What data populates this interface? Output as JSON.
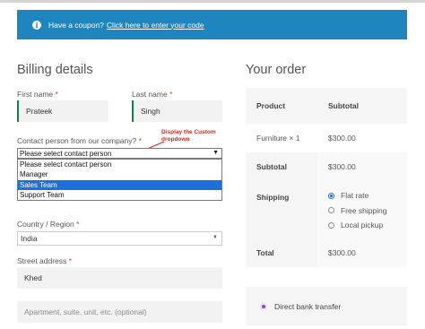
{
  "coupon": {
    "icon": "info-icon",
    "lead_text": "Have a coupon?",
    "link_text": "Click here to enter your code",
    "background": "#1e85be"
  },
  "billing": {
    "title": "Billing details",
    "first_name": {
      "label": "First name",
      "required": "*",
      "value": "Prateek"
    },
    "last_name": {
      "label": "Last name",
      "required": "*",
      "value": "Singh"
    },
    "contact_person": {
      "label": "Contact person from our company?",
      "required": "*",
      "selected": "Please select contact person",
      "options": [
        "Please select contact person",
        "Manager",
        "Sales Team",
        "Support Team"
      ],
      "highlighted_option": "Sales Team"
    },
    "annotation": "Display the Custom dropdown",
    "country": {
      "label": "Country / Region",
      "required": "*",
      "value": "India"
    },
    "street": {
      "label": "Street address",
      "required": "*",
      "value": "Khed",
      "line2_placeholder": "Apartment, suite, unit, etc. (optional)"
    }
  },
  "order": {
    "title": "Your order",
    "header": {
      "product": "Product",
      "subtotal": "Subtotal"
    },
    "item": {
      "name": "Furniture",
      "qty": "× 1",
      "price": "$300.00"
    },
    "subtotal": {
      "label": "Subtotal",
      "value": "$300.00"
    },
    "shipping": {
      "label": "Shipping",
      "options": [
        "Flat rate",
        "Free shipping",
        "Local pickup"
      ],
      "selected": "Flat rate"
    },
    "total": {
      "label": "Total",
      "value": "$300.00"
    }
  },
  "payment": {
    "method": "Direct bank transfer",
    "accent": "#7f54b3"
  }
}
